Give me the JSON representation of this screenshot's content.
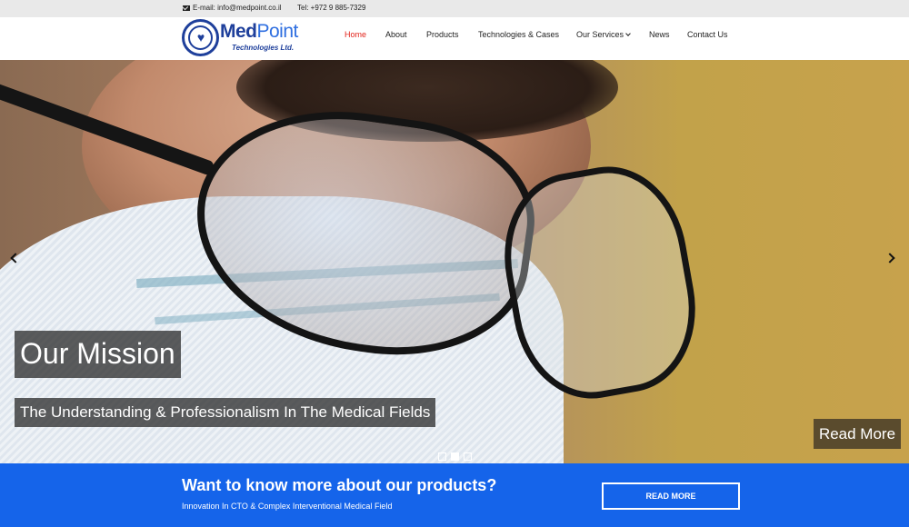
{
  "topbar": {
    "email": "E-mail: info@medpoint.co.il",
    "tel": "Tel: +972 9 885-7329"
  },
  "logo": {
    "brand_part1": "Med",
    "brand_part2": "Point",
    "subtitle": "Technologies Ltd."
  },
  "nav": {
    "items": [
      {
        "label": "Home",
        "active": true
      },
      {
        "label": "About"
      },
      {
        "label": "Products"
      },
      {
        "label": "Technologies & Cases"
      },
      {
        "label": "Our Services"
      },
      {
        "label": "News"
      },
      {
        "label": "Contact Us"
      }
    ]
  },
  "hero": {
    "title": "Our Mission",
    "subtitle": "The Understanding & Professionalism In The Medical Fields",
    "button": "Read More",
    "slide_count": 3,
    "active_slide": 2
  },
  "cta": {
    "title": "Want to know more about our products?",
    "description": "Innovation In CTO & Complex Interventional Medical Field",
    "button": "READ MORE"
  },
  "colors": {
    "accent_blue": "#1564ea",
    "nav_active": "#e2231a",
    "brand_navy": "#1e3f9b"
  }
}
